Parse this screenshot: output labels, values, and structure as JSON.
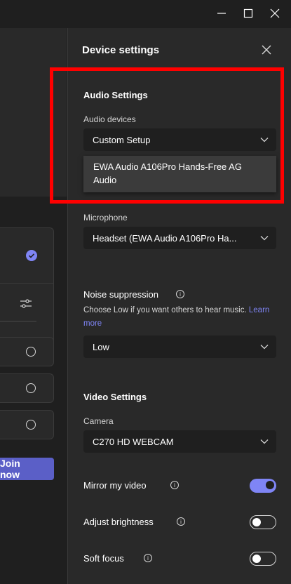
{
  "window": {
    "minimize_icon": "minimize-icon",
    "maximize_icon": "maximize-icon",
    "close_icon": "close-icon"
  },
  "left": {
    "join_label": "Join now"
  },
  "panel": {
    "title": "Device settings",
    "audio": {
      "section_title": "Audio Settings",
      "devices_label": "Audio devices",
      "devices_value": "Custom Setup",
      "dropdown_option": "EWA Audio A106Pro Hands-Free AG Audio",
      "microphone_label": "Microphone",
      "microphone_value": "Headset (EWA Audio A106Pro Ha...",
      "noise_label": "Noise suppression",
      "noise_help": "Choose Low if you want others to hear music.",
      "noise_help_link": "Learn more",
      "noise_value": "Low"
    },
    "video": {
      "section_title": "Video Settings",
      "camera_label": "Camera",
      "camera_value": "C270 HD WEBCAM",
      "mirror_label": "Mirror my video",
      "mirror_on": true,
      "brightness_label": "Adjust brightness",
      "brightness_on": false,
      "softfocus_label": "Soft focus",
      "softfocus_on": false
    }
  },
  "colors": {
    "accent": "#5b5fc7",
    "toggle_on": "#7f85f5",
    "highlight": "#ff0000",
    "panel_bg": "#292929"
  }
}
